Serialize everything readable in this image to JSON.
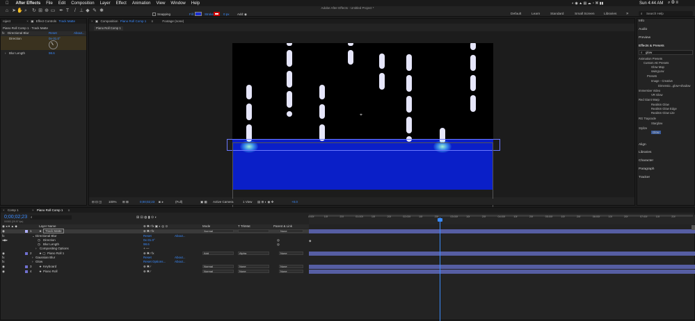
{
  "menubar": {
    "apple": "",
    "app": "After Effects",
    "items": [
      "File",
      "Edit",
      "Composition",
      "Layer",
      "Effect",
      "Animation",
      "View",
      "Window",
      "Help"
    ],
    "clock": "Sun 4:44 AM"
  },
  "title": "Adobe After Effects - Untitled Project *",
  "toolbar": {
    "snapping": "Snapping",
    "fill": "Fill:",
    "stroke": "Stroke:",
    "stroke_px": "0 px",
    "add": "Add:"
  },
  "workspaces": [
    "Default",
    "Learn",
    "Standard",
    "Small Screen",
    "Libraries"
  ],
  "search_help": "Search Help",
  "colors": {
    "accent": "#3a8bff",
    "layer_bar": "#565ea3",
    "comp_blue": "#0a1fc8",
    "drip": "#e6e6fb"
  },
  "left": {
    "project_tab": "roject",
    "effect_tab_x": "×",
    "effect_controls_label": "Effect Controls",
    "effect_controls_target": "Track Matte",
    "breadcrumb": "Piano Roll Comp 1 · Track Matte",
    "effect_name": "Directional Blur",
    "reset": "Reset",
    "about": "About...",
    "direction_label": "Direction",
    "direction_value": "0x-31.0°",
    "blur_label": "Blur Length",
    "blur_value": "98.6"
  },
  "comp": {
    "tab_label": "Composition",
    "tab_name": "Piano Roll Comp 1",
    "footage_tab": "Footage (none)",
    "subtab": "Piano Roll Comp 1",
    "bottom": {
      "zoom": "100%",
      "timecode": "0;00;02;23",
      "quality": "(Full)",
      "camera": "Active Camera",
      "view": "1 View",
      "exposure": "+0.0"
    }
  },
  "right": {
    "info": "Info",
    "audio": "Audio",
    "preview": "Preview",
    "effects_presets": "Effects & Presets",
    "search_value": "glow",
    "tree": [
      "Animation Presets",
      "Custom AE Presets",
      "Glow Map",
      "swingLow",
      "Presets",
      "Image - Creative",
      "Dimensio...glow+shadow",
      "Immersive Video",
      "VR Glow",
      "Red Giant Warp",
      "Realism Glow",
      "Realism Glow Edge",
      "Realism Glow Lite",
      "RG Trapcode",
      "Starglow",
      "Stylize",
      "Glow"
    ],
    "align": "Align",
    "libraries": "Libraries",
    "character": "Character",
    "paragraph": "Paragraph",
    "tracker": "Tracker"
  },
  "timeline": {
    "tabs": [
      "Comp 1",
      "Piano Roll Comp 1"
    ],
    "timecode": "0;00;02;23",
    "timecode_sub": "00083 (29.97 fps)",
    "headers": {
      "layer_name": "Layer Name",
      "mode": "Mode",
      "trkmat": "T TrkMat",
      "parent": "Parent & Link"
    },
    "ruler": [
      "0:00f",
      "10f",
      "20f",
      "01:00f",
      "10f",
      "20f",
      "02:00f",
      "10f",
      "20f",
      "03:00f",
      "10f",
      "20f",
      "04:00f",
      "10f",
      "20f",
      "05:00f",
      "10f",
      "20f",
      "06:00f",
      "10f",
      "20f",
      "07:00f",
      "10f",
      "20f"
    ],
    "rows": [
      {
        "num": "1",
        "name": "Track Matte",
        "mode": "Normal",
        "trk": "",
        "parent": "None",
        "sel": true
      },
      {
        "num": "",
        "name": "Directional Blur",
        "reset": "Reset",
        "about": "About..."
      },
      {
        "num": "",
        "name": "Direction",
        "value": "0x-31.0°"
      },
      {
        "num": "",
        "name": "Blur Length",
        "value": "98.6"
      },
      {
        "num": "",
        "name": "Compositing Options",
        "value": "+ —"
      },
      {
        "num": "2",
        "name": "Piano Roll 1",
        "mode": "Add",
        "trk": "Alpha",
        "parent": "None"
      },
      {
        "num": "",
        "name": "Gaussian Blur",
        "reset": "Reset",
        "about": "About..."
      },
      {
        "num": "",
        "name": "Glow",
        "reset": "Reset",
        "options": "Options...",
        "about": "About..."
      },
      {
        "num": "3",
        "name": "Keyboard",
        "mode": "Normal",
        "trk": "None",
        "parent": "None"
      },
      {
        "num": "4",
        "name": "Piano Roll",
        "mode": "Normal",
        "trk": "None",
        "parent": "None"
      }
    ]
  }
}
